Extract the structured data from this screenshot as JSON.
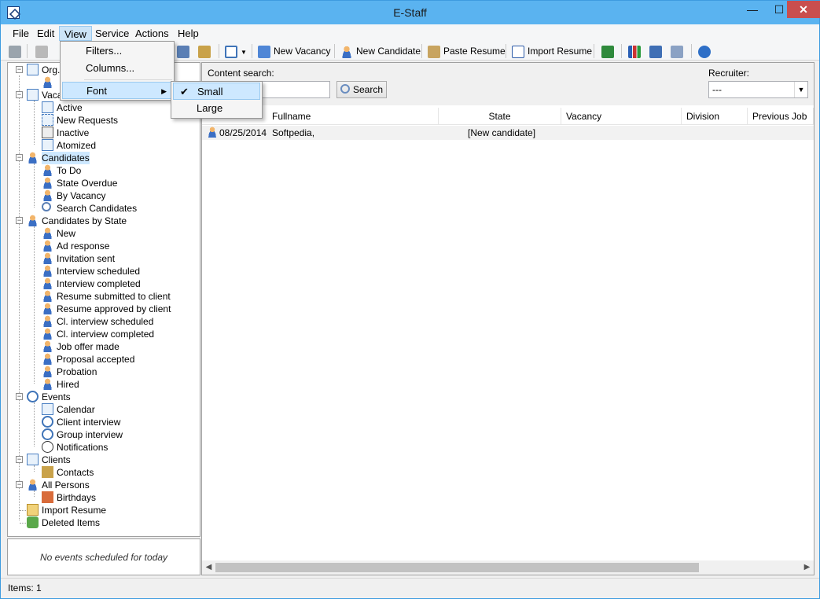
{
  "window": {
    "title": "E-Staff",
    "min_label": "—",
    "max_label": "☐",
    "close_label": "✕"
  },
  "menubar": [
    "File",
    "Edit",
    "View",
    "Service",
    "Actions",
    "Help"
  ],
  "toolbar": {
    "new_vacancy": "New Vacancy",
    "new_candidate": "New Candidate",
    "paste_resume": "Paste Resume",
    "import_resume": "Import Resume"
  },
  "view_menu": {
    "filters": "Filters...",
    "columns": "Columns...",
    "font": "Font"
  },
  "font_submenu": {
    "small": "Small",
    "large": "Large",
    "check": "✔"
  },
  "tree": {
    "org": "Org.",
    "vacancies": "Vaca",
    "active": "Active",
    "new_requests": "New Requests",
    "inactive": "Inactive",
    "atomized": "Atomized",
    "candidates": "Candidates",
    "to_do": "To Do",
    "state_overdue": "State Overdue",
    "by_vacancy": "By Vacancy",
    "search_candidates": "Search Candidates",
    "candidates_by_state": "Candidates by State",
    "states": [
      "New",
      "Ad response",
      "Invitation sent",
      "Interview scheduled",
      "Interview completed",
      "Resume submitted to client",
      "Resume approved by client",
      "Cl. interview scheduled",
      "Cl. interview completed",
      "Job offer made",
      "Proposal accepted",
      "Probation",
      "Hired"
    ],
    "events": "Events",
    "calendar": "Calendar",
    "client_interview": "Client interview",
    "group_interview": "Group interview",
    "notifications": "Notifications",
    "clients": "Clients",
    "contacts": "Contacts",
    "all_persons": "All Persons",
    "birthdays": "Birthdays",
    "import_resume": "Import Resume",
    "deleted_items": "Deleted Items"
  },
  "events_pane": {
    "message": "No events scheduled for today"
  },
  "search": {
    "content_label": "Content search:",
    "button": "Search",
    "recruiter_label": "Recruiter:",
    "recruiter_value": "---"
  },
  "grid": {
    "columns": [
      "Fullname",
      "State",
      "Vacancy",
      "Division",
      "Previous Job"
    ],
    "rows": [
      {
        "date": "08/25/2014",
        "fullname": "Softpedia,",
        "state": "[New candidate]"
      }
    ]
  },
  "status": {
    "items": "Items: 1"
  }
}
